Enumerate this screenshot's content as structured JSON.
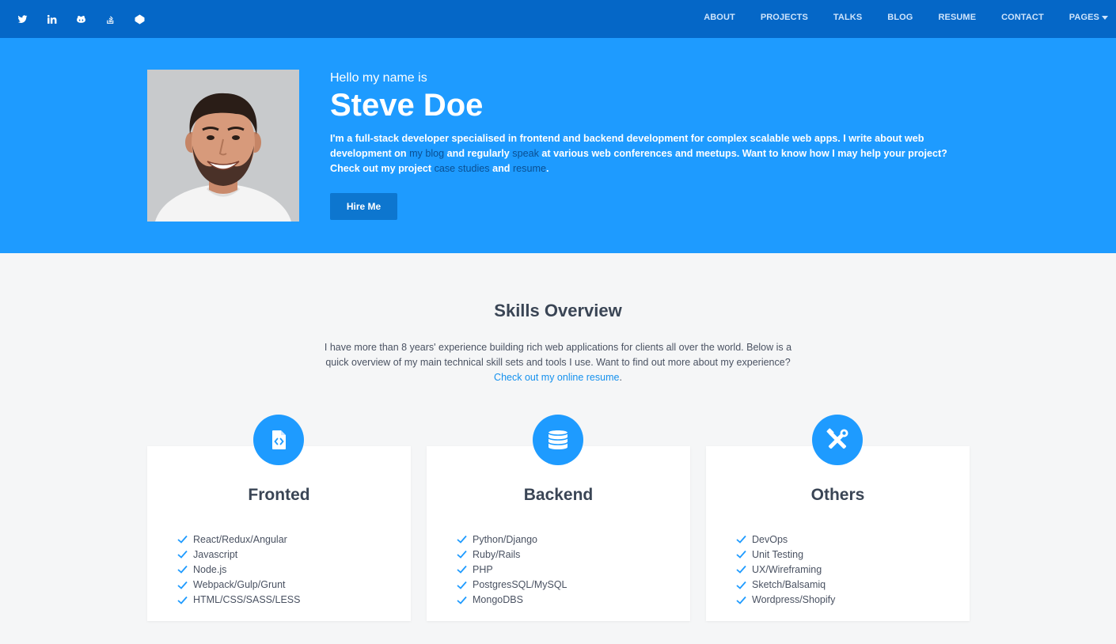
{
  "nav": {
    "social_icons": [
      "twitter-icon",
      "linkedin-icon",
      "github-icon",
      "stackoverflow-icon",
      "codepen-icon"
    ],
    "links": [
      "ABOUT",
      "PROJECTS",
      "TALKS",
      "BLOG",
      "RESUME",
      "CONTACT",
      "PAGES"
    ]
  },
  "hero": {
    "greeting": "Hello my name is",
    "name": "Steve Doe",
    "intro": {
      "p1": "I'm a full-stack developer specialised in frontend and backend development for complex scalable web apps. I write about web development on ",
      "link_blog": "my blog",
      "p2": " and regularly ",
      "link_speak": "speak",
      "p3": " at various web conferences and meetups. Want to know how I may help your project? Check out my project ",
      "link_case": "case studies",
      "p4": " and ",
      "link_resume": "resume",
      "p5": "."
    },
    "hire_button": "Hire Me"
  },
  "skills": {
    "title": "Skills Overview",
    "intro": "I have more than 8 years' experience building rich web applications for clients all over the world. Below is a quick overview of my main technical skill sets and tools I use. Want to find out more about my experience?",
    "resume_link": "Check out my online resume",
    "resume_suffix": ".",
    "cards": [
      {
        "title": "Fronted",
        "icon": "file-code-icon",
        "items": [
          "React/Redux/Angular",
          "Javascript",
          "Node.js",
          "Webpack/Gulp/Grunt",
          "HTML/CSS/SASS/LESS"
        ]
      },
      {
        "title": "Backend",
        "icon": "database-icon",
        "items": [
          "Python/Django",
          "Ruby/Rails",
          "PHP",
          "PostgresSQL/MySQL",
          "MongoDBS"
        ]
      },
      {
        "title": "Others",
        "icon": "tools-icon",
        "items": [
          "DevOps",
          "Unit Testing",
          "UX/Wireframing",
          "Sketch/Balsamiq",
          "Wordpress/Shopify"
        ]
      }
    ]
  },
  "colors": {
    "nav_bg": "#0567c7",
    "hero_bg": "#1e9bff",
    "accent": "#1e9bff",
    "button": "#0d76cf",
    "link_dark": "#0a4f92",
    "page_bg": "#f5f6f7"
  }
}
